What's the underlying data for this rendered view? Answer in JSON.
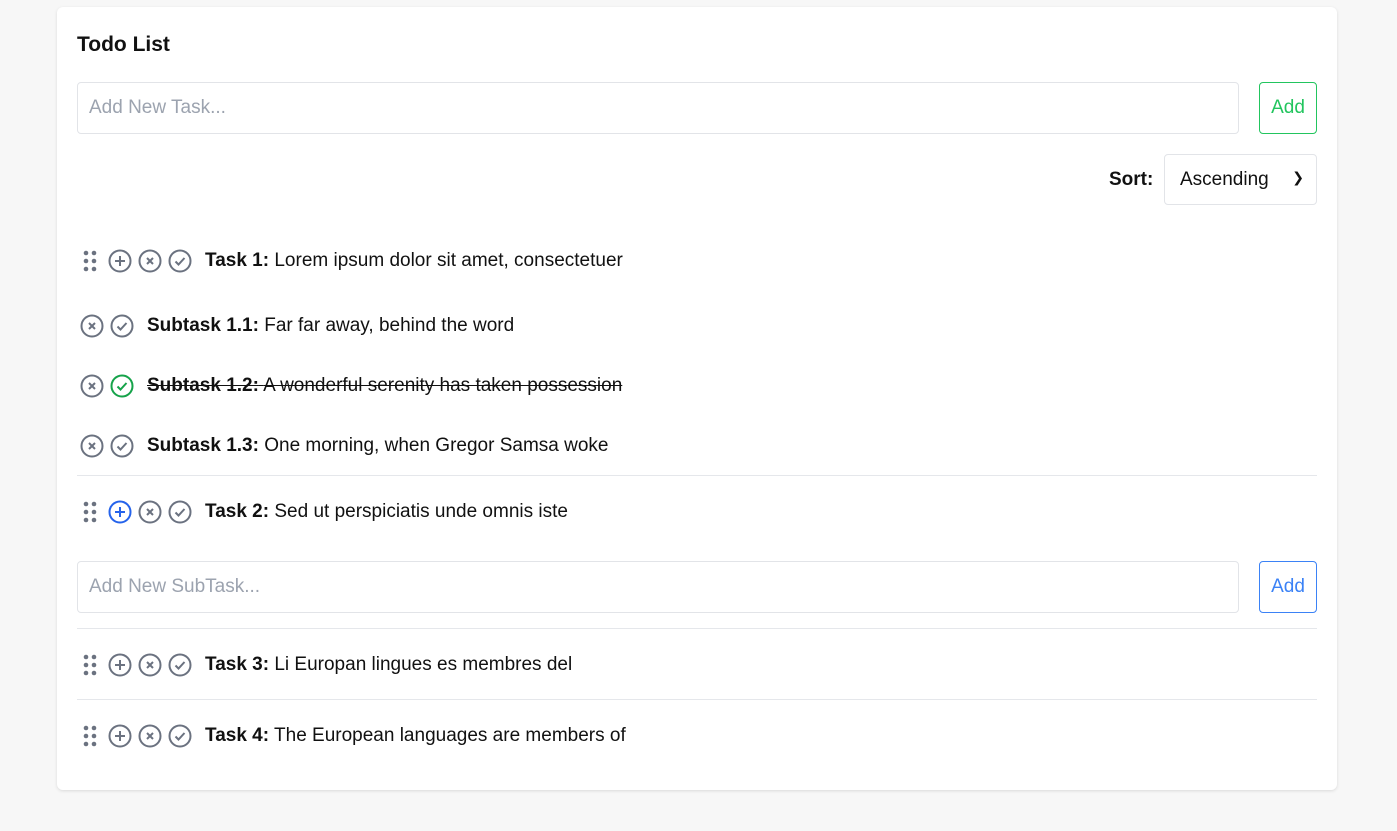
{
  "title": "Todo List",
  "new_task": {
    "placeholder": "Add New Task...",
    "add_label": "Add",
    "color": "#22c55e"
  },
  "sort": {
    "label": "Sort:",
    "value": "Ascending"
  },
  "tasks": [
    {
      "label": "Task 1:",
      "text": "Lorem ipsum dolor sit amet, consectetuer",
      "subtasks": [
        {
          "label": "Subtask 1.1:",
          "text": "Far far away, behind the word",
          "done": false
        },
        {
          "label": "Subtask 1.2:",
          "text": "A wonderful serenity has taken possession",
          "done": true
        },
        {
          "label": "Subtask 1.3:",
          "text": "One morning, when Gregor Samsa woke",
          "done": false
        }
      ]
    },
    {
      "label": "Task 2:",
      "text": "Sed ut perspiciatis unde omnis iste",
      "adding_subtask": true
    },
    {
      "label": "Task 3:",
      "text": "Li Europan lingues es membres del"
    },
    {
      "label": "Task 4:",
      "text": "The European languages are members of"
    }
  ],
  "new_subtask": {
    "placeholder": "Add New SubTask...",
    "add_label": "Add",
    "color": "#3b82f6"
  },
  "colors": {
    "icon": "#6b7280",
    "done": "#16a34a",
    "active": "#2563eb"
  }
}
